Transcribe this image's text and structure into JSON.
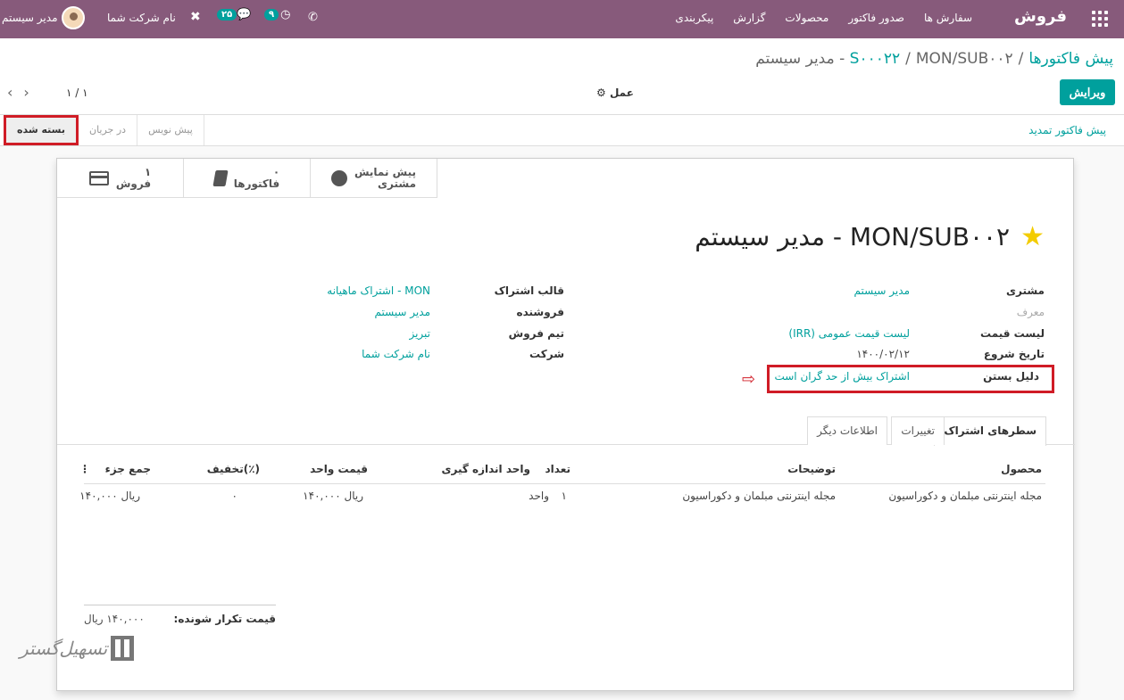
{
  "navbar": {
    "brand": "فروش",
    "menu": [
      "سفارش ها",
      "صدور فاکتور",
      "محصولات",
      "گزارش",
      "پیکربندی"
    ],
    "user_name": "مدیر سیستم",
    "company": "نام شرکت شما",
    "chat_count": "۲۵",
    "activity_count": "۹"
  },
  "breadcrumb": {
    "root": "پیش فاکتورها",
    "parent": "S۰۰۰۲۲",
    "current": "MON/SUB۰۰۲ - مدیر سیستم"
  },
  "controls": {
    "edit": "ویرایش",
    "action": "⚙ عمل",
    "pager": "۱ / ۱"
  },
  "statusbar": {
    "renew": "پیش فاکتور تمدید",
    "stages": [
      "بسته شده",
      "در جریان",
      "پیش نویس"
    ]
  },
  "smart_buttons": [
    {
      "count": "۱",
      "label": "فروش",
      "icon": "credit-card-icon"
    },
    {
      "count": "۰",
      "label": "فاکتورها",
      "icon": "book-icon"
    },
    {
      "count": "پیش نمایش",
      "label": "مشتری",
      "icon": "globe-icon"
    }
  ],
  "record": {
    "title": "MON/SUB۰۰۲ - مدیر سیستم"
  },
  "fields_right": [
    {
      "label": "مشتری",
      "value": "مدیر سیستم"
    },
    {
      "label": "معرف",
      "value": ""
    },
    {
      "label": "لیست قیمت",
      "value": "لیست قیمت عمومی (IRR)"
    },
    {
      "label": "تاریخ شروع",
      "value": "۱۴۰۰/۰۲/۱۲"
    },
    {
      "label": "دلیل بستن",
      "value": "اشتراک بیش از حد گران است"
    }
  ],
  "fields_left": [
    {
      "label": "قالب اشتراک",
      "value": "MON - اشتراک ماهیانه"
    },
    {
      "label": "فروشنده",
      "value": "مدیر سیستم"
    },
    {
      "label": "تیم فروش",
      "value": "تبریز"
    },
    {
      "label": "شرکت",
      "value": "نام شرکت شما"
    }
  ],
  "tabs": [
    "سطرهای اشتراک",
    "تغییرات",
    "اطلاعات دیگر"
  ],
  "table": {
    "headers": {
      "product": "محصول",
      "description": "توضیحات",
      "qty": "تعداد",
      "uom": "واحد اندازه گیری",
      "price": "قیمت واحد",
      "discount": "تخفیف(٪)",
      "subtotal": "جمع جزء"
    },
    "rows": [
      {
        "product": "مجله اینترنتی مبلمان و دکوراسیون",
        "description": "مجله اینترنتی مبلمان و دکوراسیون",
        "qty": "۱",
        "uom": "واحد",
        "price": "۱۴۰,۰۰۰ ریال",
        "discount": "۰",
        "subtotal": "۱۴۰,۰۰۰ ریال"
      }
    ]
  },
  "recurring": {
    "label": "قیمت تکرار شونده:",
    "value": "۱۴۰,۰۰۰ ریال"
  },
  "watermark": {
    "text": "تسهیل‌گستر"
  },
  "colors": {
    "navbar": "#875a7b",
    "accent": "#00a09d",
    "highlight": "#d01c26",
    "star": "#f3cc00"
  }
}
